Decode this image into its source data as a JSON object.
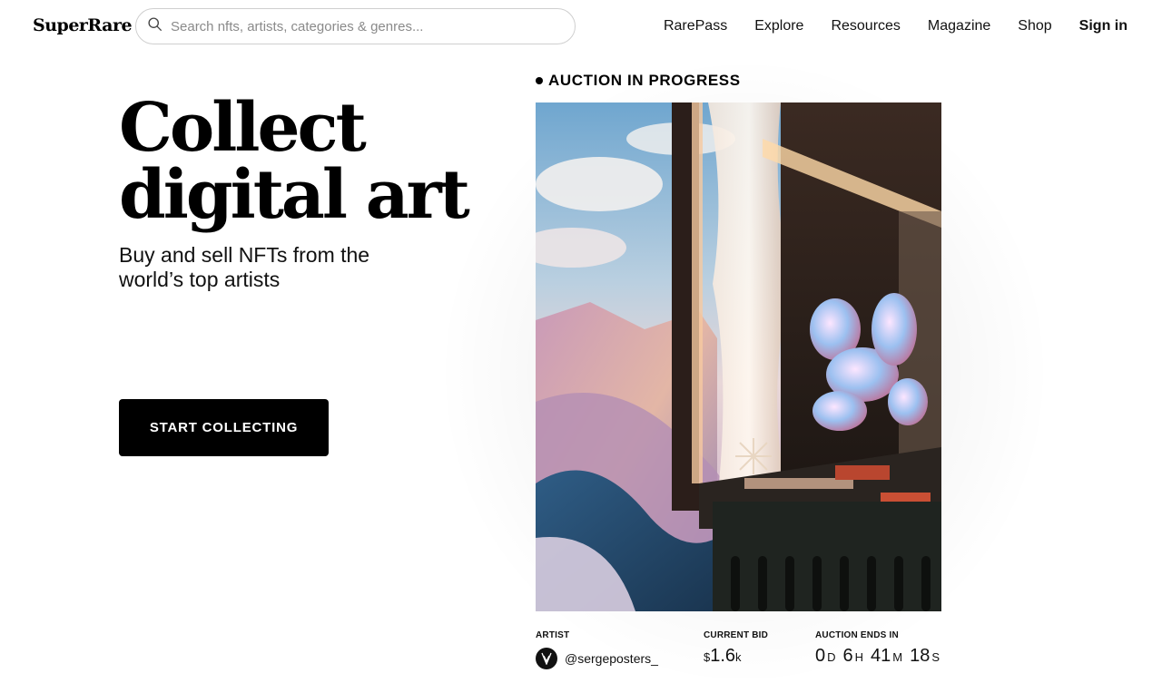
{
  "header": {
    "logo": "SuperRare",
    "search": {
      "placeholder": "Search nfts, artists, categories & genres..."
    },
    "nav": [
      {
        "label": "RarePass"
      },
      {
        "label": "Explore"
      },
      {
        "label": "Resources"
      },
      {
        "label": "Magazine"
      },
      {
        "label": "Shop"
      },
      {
        "label": "Sign in"
      }
    ]
  },
  "hero": {
    "title_line1": "Collect",
    "title_line2": "digital art",
    "subtitle": "Buy and sell NFTs from the world’s top artists",
    "cta_label": "START COLLECTING"
  },
  "auction": {
    "status": "AUCTION IN PROGRESS",
    "artist_label": "ARTIST",
    "artist_handle": "@sergeposters_",
    "bid_label": "CURRENT BID",
    "bid_currency": "$",
    "bid_value": "1.6",
    "bid_suffix": "k",
    "ends_label": "AUCTION ENDS IN",
    "countdown": {
      "days": "0",
      "days_unit": "D",
      "hours": "6",
      "hours_unit": "H",
      "minutes": "41",
      "minutes_unit": "M",
      "seconds": "18",
      "seconds_unit": "S"
    }
  },
  "colors": {
    "accent": "#000000",
    "border": "#cfcfcf",
    "placeholder": "#8a8a8a"
  }
}
